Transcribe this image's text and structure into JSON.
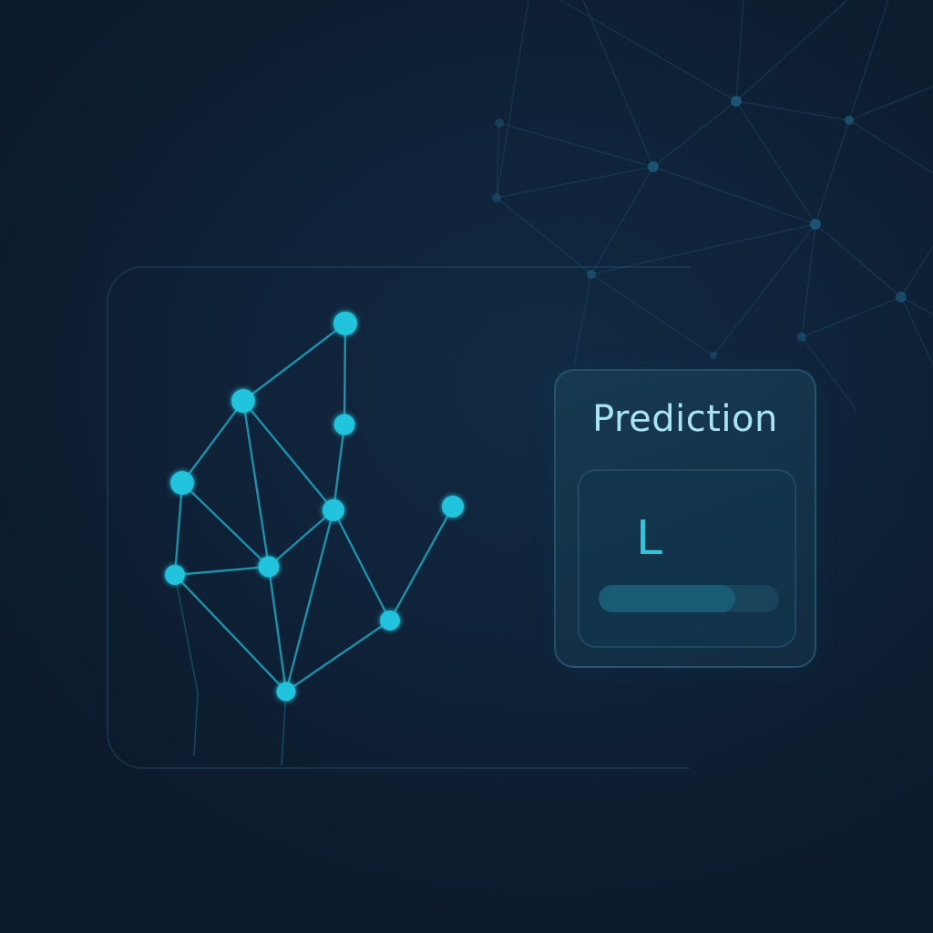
{
  "prediction": {
    "title": "Prediction",
    "letter": "L",
    "confidence": 0.76
  },
  "colors": {
    "background": "#0d1c2e",
    "node": "#21c3dc",
    "edge": "#1fa5bf",
    "background_network": "#1b4a64",
    "title_text": "#a9e4f2",
    "letter_text": "#2fc6dd",
    "bar_fill": "#1a5b74"
  }
}
